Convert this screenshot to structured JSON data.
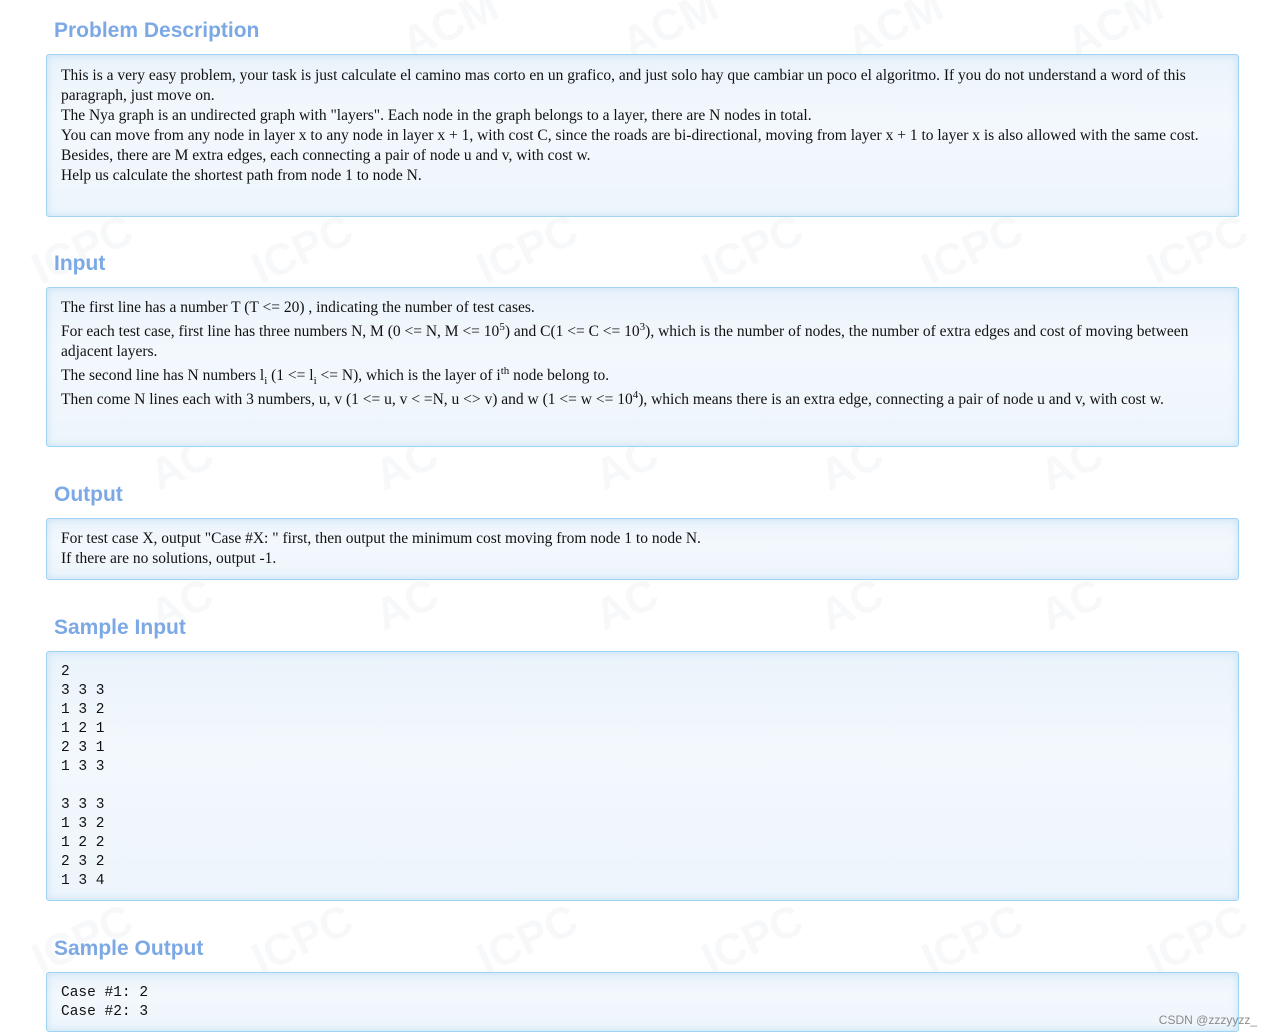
{
  "sections": {
    "description": {
      "title": "Problem Description",
      "lines": [
        "This is a very easy problem, your task is just calculate el camino mas corto en un grafico, and just solo hay que cambiar un poco el algoritmo. If you do not understand a word of this paragraph, just move on.",
        "The Nya graph is an undirected graph with \"layers\". Each node in the graph belongs to a layer, there are N nodes in total.",
        "You can move from any node in layer x to any node in layer x + 1, with cost C, since the roads are bi-directional, moving from layer x + 1 to layer x is also allowed with the same cost.",
        "Besides, there are M extra edges, each connecting a pair of node u and v, with cost w.",
        "Help us calculate the shortest path from node 1 to node N."
      ]
    },
    "input": {
      "title": "Input",
      "line1": "The first line has a number T (T <= 20) , indicating the number of test cases.",
      "line2": {
        "p1": "For each test case, first line has three numbers N, M (0 <= N, M <= 10",
        "sup1": "5",
        "p2": ") and C(1 <= C <= 10",
        "sup2": "3",
        "p3": "), which is the number of nodes, the number of extra edges and cost of moving between adjacent layers."
      },
      "line3": {
        "p1": "The second line has N numbers l",
        "sub1": "i",
        "p2": " (1 <= l",
        "sub2": "i",
        "p3": " <= N), which is the layer of i",
        "sup": "th",
        "p4": " node belong to."
      },
      "line4": {
        "p1": "Then come N lines each with 3 numbers, u, v (1 <= u, v < =N, u <> v) and w (1 <= w <= 10",
        "sup": "4",
        "p2": "), which means there is an extra edge, connecting a pair of node u and v, with cost w."
      }
    },
    "output": {
      "title": "Output",
      "lines": [
        "For test case X, output \"Case #X: \" first, then output the minimum cost moving from node 1 to node N.",
        "If there are no solutions, output -1."
      ]
    },
    "sample_input": {
      "title": "Sample Input",
      "text": "2\n3 3 3\n1 3 2\n1 2 1\n2 3 1\n1 3 3\n\n3 3 3\n1 3 2\n1 2 2\n2 3 2\n1 3 4"
    },
    "sample_output": {
      "title": "Sample Output",
      "text": "Case #1: 2\nCase #2: 3"
    }
  },
  "watermarks": {
    "text_a": "ICPC",
    "text_b": "ACM",
    "text_c": "AC"
  },
  "credit": "CSDN @zzzyyzz_"
}
